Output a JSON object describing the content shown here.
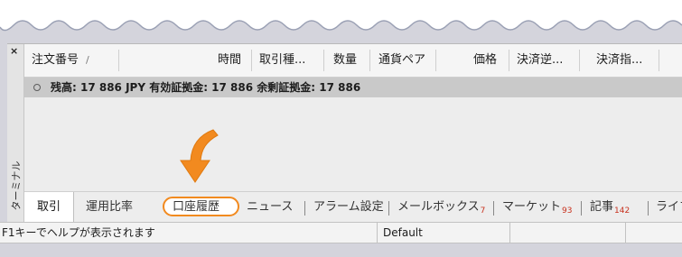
{
  "terminal": {
    "side_title": "ターミナル",
    "close_icon": "close-icon"
  },
  "columns": [
    {
      "label": "注文番号",
      "sort": "/"
    },
    {
      "label": "時間"
    },
    {
      "label": "取引種..."
    },
    {
      "label": "数量"
    },
    {
      "label": "通貨ペア"
    },
    {
      "label": "価格"
    },
    {
      "label": "決済逆..."
    },
    {
      "label": "決済指..."
    }
  ],
  "balance_row": {
    "text": "残高: 17 886 JPY  有効証拠金: 17 886  余剰証拠金: 17 886"
  },
  "tabs": [
    {
      "label": "取引",
      "active": true
    },
    {
      "label": "運用比率"
    },
    {
      "label": "口座履歴",
      "highlighted": true
    },
    {
      "label": "ニュース"
    },
    {
      "label": "アラーム設定"
    },
    {
      "label": "メールボックス",
      "badge": "7"
    },
    {
      "label": "マーケット",
      "badge": "93"
    },
    {
      "label": "記事",
      "badge": "142"
    },
    {
      "label": "ライブ"
    }
  ],
  "status_bar": {
    "help_text": "F1キーでヘルプが表示されます",
    "profile": "Default"
  },
  "colors": {
    "highlight": "#f28a1f",
    "badge": "#c8321e"
  },
  "annotation": {
    "arrow_icon": "pointing-arrow-icon"
  }
}
